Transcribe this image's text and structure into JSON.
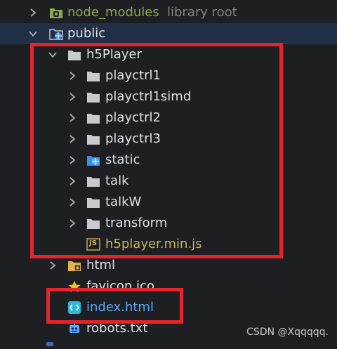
{
  "tree": {
    "node_modules": {
      "name": "node_modules",
      "suffix": "library root"
    },
    "public": {
      "name": "public"
    },
    "h5Player": {
      "name": "h5Player"
    },
    "h5Player_children": [
      {
        "name": "playctrl1",
        "icon": "folder-icon"
      },
      {
        "name": "playctrl1simd",
        "icon": "folder-icon"
      },
      {
        "name": "playctrl2",
        "icon": "folder-icon"
      },
      {
        "name": "playctrl3",
        "icon": "folder-icon"
      },
      {
        "name": "static",
        "icon": "web-folder-icon"
      },
      {
        "name": "talk",
        "icon": "folder-icon"
      },
      {
        "name": "talkW",
        "icon": "folder-icon"
      },
      {
        "name": "transform",
        "icon": "folder-icon"
      }
    ],
    "h5player_js": {
      "name": "h5player.min.js",
      "badge": "JS"
    },
    "html": {
      "name": "html"
    },
    "favicon": {
      "name": "favicon.ico"
    },
    "index": {
      "name": "index.html"
    },
    "robots": {
      "name": "robots.txt"
    }
  },
  "watermark": "CSDN @Xqqqqq.",
  "colors": {
    "background": "#1e1f22",
    "selection": "#213047",
    "highlight_box": "#e7242b",
    "node_modules_text": "#8ea847",
    "index_text": "#5aa7ff",
    "js_text": "#c9b35a"
  }
}
